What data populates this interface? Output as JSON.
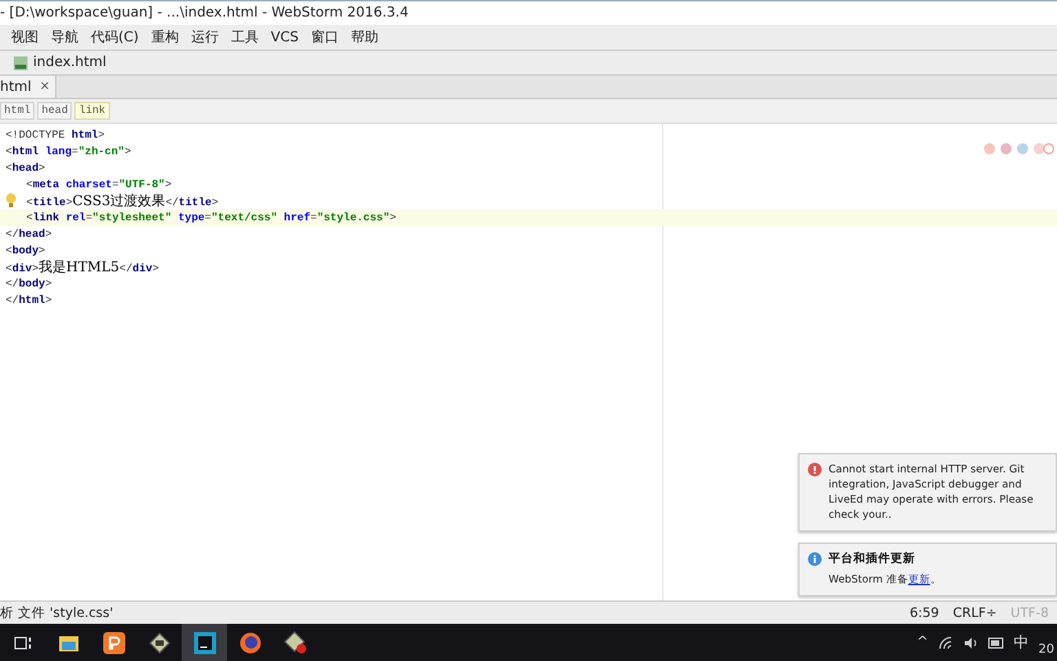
{
  "window": {
    "title": "- [D:\\workspace\\guan] - ...\\index.html - WebStorm 2016.3.4"
  },
  "menu": [
    "视图",
    "导航",
    "代码(C)",
    "重构",
    "运行",
    "工具",
    "VCS",
    "窗口",
    "帮助"
  ],
  "nav_bar": {
    "file": "index.html"
  },
  "tabs": [
    {
      "label": "html",
      "close": "×",
      "selected": true
    }
  ],
  "breadcrumbs": [
    {
      "label": "html",
      "selected": false
    },
    {
      "label": "head",
      "selected": false
    },
    {
      "label": "link",
      "selected": true
    }
  ],
  "code_lines": [
    {
      "segments": [
        {
          "kind": "punct",
          "text": "<!DOCTYPE "
        },
        {
          "kind": "tag",
          "text": "html"
        },
        {
          "kind": "punct",
          "text": ">"
        }
      ]
    },
    {
      "segments": [
        {
          "kind": "punct",
          "text": "<"
        },
        {
          "kind": "tag",
          "text": "html "
        },
        {
          "kind": "attr",
          "text": "lang"
        },
        {
          "kind": "punct",
          "text": "="
        },
        {
          "kind": "value",
          "text": "\"zh-cn\""
        },
        {
          "kind": "punct",
          "text": ">"
        }
      ]
    },
    {
      "segments": [
        {
          "kind": "punct",
          "text": "<"
        },
        {
          "kind": "tag",
          "text": "head"
        },
        {
          "kind": "punct",
          "text": ">"
        }
      ],
      "children": [
        {
          "segments": [
            {
              "kind": "punct",
              "text": "<"
            },
            {
              "kind": "tag",
              "text": "meta "
            },
            {
              "kind": "attr",
              "text": "charset"
            },
            {
              "kind": "punct",
              "text": "="
            },
            {
              "kind": "value",
              "text": "\"UTF-8\""
            },
            {
              "kind": "punct",
              "text": ">"
            }
          ]
        },
        {
          "hint": true,
          "segments": [
            {
              "kind": "punct",
              "text": "<"
            },
            {
              "kind": "tag",
              "text": "title"
            },
            {
              "kind": "punct",
              "text": ">"
            },
            {
              "kind": "text",
              "text": "CSS3过渡效果"
            },
            {
              "kind": "punct",
              "text": "</"
            },
            {
              "kind": "tag",
              "text": "title"
            },
            {
              "kind": "punct",
              "text": ">"
            }
          ]
        },
        {
          "current": true,
          "segments": [
            {
              "kind": "punct",
              "text": "<"
            },
            {
              "kind": "tag",
              "text": "link "
            },
            {
              "kind": "attr",
              "text": "rel"
            },
            {
              "kind": "punct",
              "text": "="
            },
            {
              "kind": "value",
              "text": "\"stylesheet\" "
            },
            {
              "kind": "attr",
              "text": "type"
            },
            {
              "kind": "punct",
              "text": "="
            },
            {
              "kind": "value",
              "text": "\"text/css\" "
            },
            {
              "kind": "attr",
              "text": "href"
            },
            {
              "kind": "punct",
              "text": "="
            },
            {
              "kind": "value",
              "text": "\"style.css\""
            },
            {
              "kind": "punct",
              "text": ">"
            }
          ]
        }
      ]
    },
    {
      "segments": [
        {
          "kind": "punct",
          "text": "</"
        },
        {
          "kind": "tag",
          "text": "head"
        },
        {
          "kind": "punct",
          "text": ">"
        }
      ]
    },
    {
      "segments": [
        {
          "kind": "punct",
          "text": "<"
        },
        {
          "kind": "tag",
          "text": "body"
        },
        {
          "kind": "punct",
          "text": ">"
        }
      ]
    },
    {
      "segments": [
        {
          "kind": "punct",
          "text": "<"
        },
        {
          "kind": "tag",
          "text": "div"
        },
        {
          "kind": "punct",
          "text": ">"
        },
        {
          "kind": "text",
          "text": "我是HTML5"
        },
        {
          "kind": "punct",
          "text": "</"
        },
        {
          "kind": "tag",
          "text": "div"
        },
        {
          "kind": "punct",
          "text": ">"
        }
      ]
    },
    {
      "segments": [
        {
          "kind": "punct",
          "text": "</"
        },
        {
          "kind": "tag",
          "text": "body"
        },
        {
          "kind": "punct",
          "text": ">"
        }
      ]
    },
    {
      "segments": [
        {
          "kind": "punct",
          "text": "</"
        },
        {
          "kind": "tag",
          "text": "html"
        },
        {
          "kind": "punct",
          "text": ">"
        }
      ]
    }
  ],
  "notifications": [
    {
      "kind": "error",
      "body": "Cannot start internal HTTP server. Git integration, JavaScript debugger and LiveEd may operate with errors. Please check your.."
    },
    {
      "kind": "info",
      "title": "平台和插件更新",
      "body": "WebStorm 准备",
      "link": "更新",
      "after": "。"
    }
  ],
  "status_bar": {
    "message": "析 文件 'style.css'",
    "position": "6:59",
    "line_separator": "CRLF÷",
    "encoding": "UTF-8"
  },
  "taskbar": {
    "apps": [
      {
        "kind": "taskview",
        "selected": false
      },
      {
        "kind": "folder",
        "selected": false
      },
      {
        "kind": "slides",
        "selected": false
      },
      {
        "kind": "tool",
        "selected": false
      },
      {
        "kind": "ide",
        "selected": true
      },
      {
        "kind": "browser",
        "selected": false
      },
      {
        "kind": "tool-error",
        "selected": false
      }
    ],
    "tray": {
      "chevron": "^",
      "ime": "中",
      "clock": "20"
    }
  }
}
